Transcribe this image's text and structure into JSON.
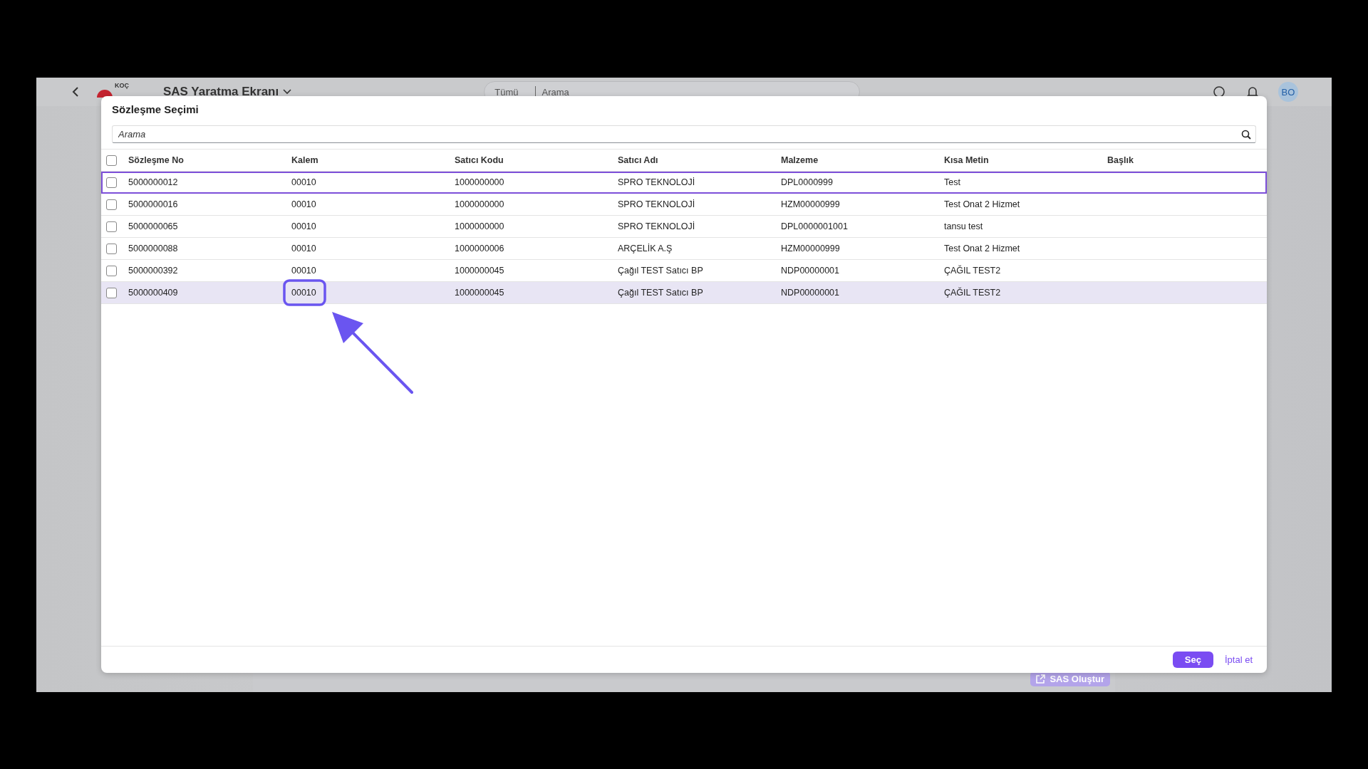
{
  "app_header": {
    "brand": "KOÇ",
    "title": "SAS Yaratma Ekranı",
    "search_scope": "Tümü",
    "search_placeholder": "Arama",
    "avatar": "BO"
  },
  "background_button": {
    "label": "SAS Oluştur",
    "disabled": true
  },
  "dialog": {
    "title": "Sözleşme Seçimi",
    "search": {
      "placeholder": "Arama"
    },
    "table": {
      "select_all_checked": false,
      "columns": [
        "Sözleşme No",
        "Kalem",
        "Satıcı Kodu",
        "Satıcı Adı",
        "Malzeme",
        "Kısa Metin",
        "Başlık"
      ],
      "rows": [
        {
          "checked": false,
          "focused": true,
          "selected": false,
          "cells": [
            "5000000012",
            "00010",
            "1000000000",
            "SPRO TEKNOLOJİ",
            "DPL0000999",
            "Test"
          ]
        },
        {
          "checked": false,
          "focused": false,
          "selected": false,
          "cells": [
            "5000000016",
            "00010",
            "1000000000",
            "SPRO TEKNOLOJİ",
            "HZM00000999",
            "Test Onat 2 Hizmet"
          ]
        },
        {
          "checked": false,
          "focused": false,
          "selected": false,
          "cells": [
            "5000000065",
            "00010",
            "1000000000",
            "SPRO TEKNOLOJİ",
            "DPL0000001001",
            "tansu test"
          ]
        },
        {
          "checked": false,
          "focused": false,
          "selected": false,
          "cells": [
            "5000000088",
            "00010",
            "1000000006",
            "ARÇELİK A.Ş",
            "HZM00000999",
            "Test Onat 2 Hizmet"
          ]
        },
        {
          "checked": false,
          "focused": false,
          "selected": false,
          "cells": [
            "5000000392",
            "00010",
            "1000000045",
            "Çağıl TEST Satıcı BP",
            "NDP00000001",
            "ÇAĞIL TEST2"
          ]
        },
        {
          "checked": false,
          "focused": false,
          "selected": true,
          "cells": [
            "5000000409",
            "00010",
            "1000000045",
            "Çağıl TEST Satıcı BP",
            "NDP00000001",
            "ÇAĞIL TEST2"
          ]
        }
      ]
    },
    "buttons": [
      {
        "label": "Seç",
        "kind": "primary"
      },
      {
        "label": "İptal et",
        "kind": "link"
      }
    ]
  }
}
